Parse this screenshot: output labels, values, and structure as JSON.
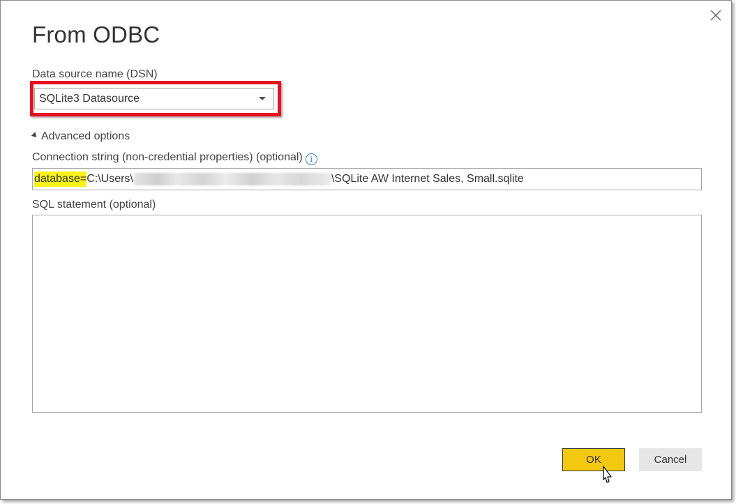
{
  "dialog": {
    "title": "From ODBC",
    "close_icon": "close-icon"
  },
  "dsn": {
    "label": "Data source name (DSN)",
    "selected": "SQLite3 Datasource",
    "highlight_color": "#e8101e"
  },
  "advanced": {
    "toggle_label": "Advanced options",
    "connection_string_label": "Connection string (non-credential properties) (optional)",
    "connection_string": {
      "highlighted_part": "database=",
      "prefix": "C:\\Users\\",
      "suffix": "\\SQLite AW Internet Sales, Small.sqlite"
    },
    "sql_label": "SQL statement (optional)",
    "sql_value": ""
  },
  "buttons": {
    "ok_label": "OK",
    "cancel_label": "Cancel"
  },
  "colors": {
    "accent": "#f2c811",
    "text_highlight": "#f6f21a",
    "info_icon": "#3b7fc4"
  }
}
